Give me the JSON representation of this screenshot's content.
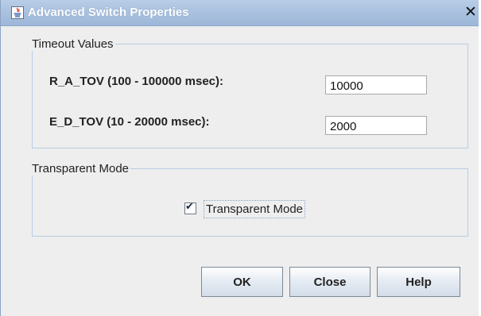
{
  "window": {
    "title": "Advanced Switch Properties",
    "close_glyph": "✕",
    "app_icon": "java-icon"
  },
  "timeout_group": {
    "legend": "Timeout Values",
    "ratov": {
      "label": "R_A_TOV  (100 - 100000 msec):",
      "value": "10000"
    },
    "edtov": {
      "label": "E_D_TOV  (10 - 20000 msec):",
      "value": "2000"
    }
  },
  "transparent_group": {
    "legend": "Transparent Mode",
    "checkbox": {
      "label": "Transparent Mode",
      "checked": true,
      "check_glyph": "✔"
    }
  },
  "buttons": {
    "ok": "OK",
    "close": "Close",
    "help": "Help"
  },
  "colors": {
    "title_bar": "#a9c1de",
    "title_text": "#ffffff",
    "dialog_bg": "#eeeeee",
    "group_border": "#b7cde4"
  }
}
